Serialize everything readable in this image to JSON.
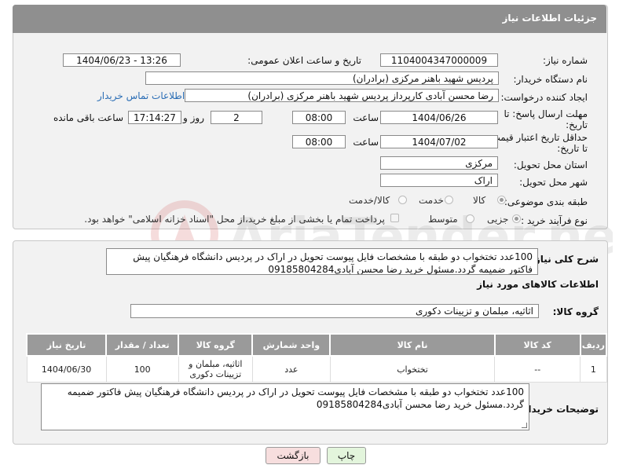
{
  "header": {
    "title": "جزئیات اطلاعات نیاز"
  },
  "fields": {
    "need_number_label": "شماره نیاز:",
    "need_number": "1104004347000009",
    "announce_label": "تاریخ و ساعت اعلان عمومی:",
    "announce_value": "1404/06/23 - 13:26",
    "buyer_label": "نام دستگاه خریدار:",
    "buyer_value": "پردیس شهید باهنر مرکزی (برادران)",
    "creator_label": "ایجاد کننده درخواست:",
    "creator_value": "رضا محسن آبادی کارپرداز پردیس شهید باهنر مرکزی (برادران)",
    "contact_link": "اطلاعات تماس خریدار",
    "deadline_label": "مهلت ارسال پاسخ: تا تاریخ:",
    "deadline_date": "1404/06/26",
    "time_label": "ساعت",
    "deadline_time": "08:00",
    "days_value": "2",
    "days_label": "روز و",
    "remaining_time": "17:14:27",
    "remaining_label": "ساعت باقی مانده",
    "validity_label": "حداقل تاریخ اعتبار قیمت: تا تاریخ:",
    "validity_date": "1404/07/02",
    "validity_time_label": "ساعت",
    "validity_time": "08:00",
    "province_label": "استان محل تحویل:",
    "province_value": "مرکزی",
    "city_label": "شهر محل تحویل:",
    "city_value": "اراک",
    "category_label": "طبقه بندی موضوعی:",
    "category_options": [
      "کالا",
      "خدمت",
      "کالا/خدمت"
    ],
    "process_label": "نوع فرآیند خرید :",
    "process_options": [
      "جزیی",
      "متوسط"
    ],
    "payment_note": "پرداخت تمام یا بخشی از مبلغ خرید،از محل \"اسناد خزانه اسلامی\" خواهد بود."
  },
  "details": {
    "description_label": "شرح کلی نیاز:",
    "description_value": "100عدد تختخواب دو طبقه با مشخصات فایل پیوست تحویل در اراک در پردیس دانشگاه فرهنگیان پیش فاکتور ضمیمه گردد.مسئول خرید رضا محسن آبادی09185804284",
    "items_info_title": "اطلاعات کالاهای مورد نیاز",
    "group_label": "گروه کالا:",
    "group_value": "اثاثیه، مبلمان و تزیینات دکوری"
  },
  "table": {
    "headers": [
      "ردیف",
      "کد کالا",
      "نام کالا",
      "واحد شمارش",
      "گروه کالا",
      "تعداد / مقدار",
      "تاریخ نیاز"
    ],
    "rows": [
      [
        "1",
        "--",
        "تختخواب",
        "عدد",
        "اثاثیه، مبلمان و تزیینات دکوری",
        "100",
        "1404/06/30"
      ]
    ]
  },
  "buyer_notes": {
    "label": "توضیحات خریدار:",
    "value": "100عدد تختخواب دو طبقه با مشخصات فایل پیوست تحویل در اراک در پردیس دانشگاه فرهنگیان پیش فاکتور ضمیمه گردد.مسئول خرید رضا محسن آبادی09185804284"
  },
  "buttons": {
    "print": "چاپ",
    "back": "بازگشت"
  },
  "watermark": {
    "text": "AriaTender.neT"
  },
  "colors": {
    "header": "#8f8f8f",
    "link": "#2a6db5",
    "back_button": "#f7dede",
    "print_button": "#e3f5dc"
  }
}
